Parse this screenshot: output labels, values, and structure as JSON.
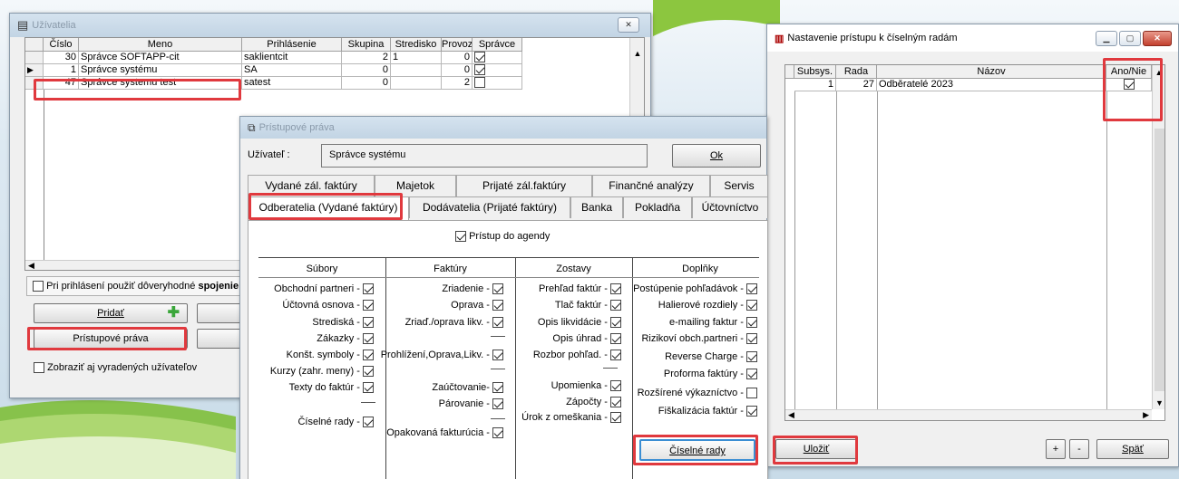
{
  "users_window": {
    "title": "Užívatelia",
    "close": "✕",
    "columns": [
      "Číslo",
      "Meno",
      "Prihlásenie",
      "Skupina",
      "Stredisko",
      "Provoz",
      "Správce"
    ],
    "rows": [
      {
        "cislo": "30",
        "meno": "Správce SOFTAPP-cit",
        "prihlasenie": "saklientcit",
        "skupina": "2",
        "stredisko": "1",
        "provoz": "0",
        "spravce": true
      },
      {
        "cislo": "1",
        "meno": "Správce systému",
        "prihlasenie": "SA",
        "skupina": "0",
        "stredisko": "",
        "provoz": "0",
        "spravce": true
      },
      {
        "cislo": "47",
        "meno": "Správce systemu test",
        "prihlasenie": "satest",
        "skupina": "0",
        "stredisko": "",
        "provoz": "2",
        "spravce": false
      }
    ],
    "trusted_label": "Pri prihlásení použiť dôveryhodné ",
    "trusted_bold": "spojenie",
    "trusted_tail": " (",
    "add_button": "Pridať",
    "rights_button": "Prístupové práva",
    "show_retired": "Zobraziť aj vyradených užívateľov"
  },
  "rights_window": {
    "title": "Prístupové práva",
    "user_label": "Užívateľ :",
    "user_value": "Správce systému",
    "ok_button": "Ok",
    "tabs_row1": [
      "Vydané zál. faktúry",
      "Majetok",
      "Prijaté zál.faktúry",
      "Finančné analýzy",
      "Servis"
    ],
    "tabs_row2": [
      "Odberatelia (Vydané faktúry)",
      "Dodávatelia (Prijaté faktúry)",
      "Banka",
      "Pokladňa",
      "Účtovníctvo"
    ],
    "agenda_access": "Prístup do agendy",
    "col_subory": "Súbory",
    "col_faktury": "Faktúry",
    "col_zostavy": "Zostavy",
    "col_doplnky": "Doplňky",
    "subory": [
      "Obchodní partneri -",
      "Účtovná osnova -",
      "Strediská -",
      "Zákazky -",
      "Konšt. symboly -",
      "Kurzy (zahr. meny) -",
      "Texty do faktúr -",
      "Číselné rady -"
    ],
    "faktury": [
      "Zriadenie -",
      "Oprava -",
      "Zriaď./oprava likv. -",
      "Prohlížení,Oprava,Likv. -",
      "Zaúčtovanie-",
      "Párovanie -",
      "Opakovaná fakturúcia -"
    ],
    "zostavy": [
      "Prehľad faktúr -",
      "Tlač faktúr -",
      "Opis likvidácie -",
      "Opis úhrad -",
      "Rozbor pohľad. -",
      "Upomienka -",
      "Zápočty -",
      "Úrok z omeškania -"
    ],
    "doplnky": [
      "Postúpenie pohľadávok -",
      "Halierové rozdiely -",
      "e-mailing faktur -",
      "Rizikoví obch.partneri -",
      "Reverse Charge -",
      "Proforma faktúry -",
      "Rozšírené výkazníctvo -",
      "Fiškalizácia faktúr -"
    ],
    "ciselne_rady_button": "Číselné rady"
  },
  "series_window": {
    "title": "Nastavenie prístupu k číselným radám",
    "columns": [
      "Subsys.",
      "Rada",
      "Názov",
      "Ano/Nie"
    ],
    "rows": [
      {
        "subsys": "1",
        "rada": "27",
        "nazov": "Odběratelé 2023",
        "ano": true
      }
    ],
    "save_button": "Uložiť",
    "plus_button": "+",
    "minus_button": "-",
    "back_button": "Späť"
  }
}
